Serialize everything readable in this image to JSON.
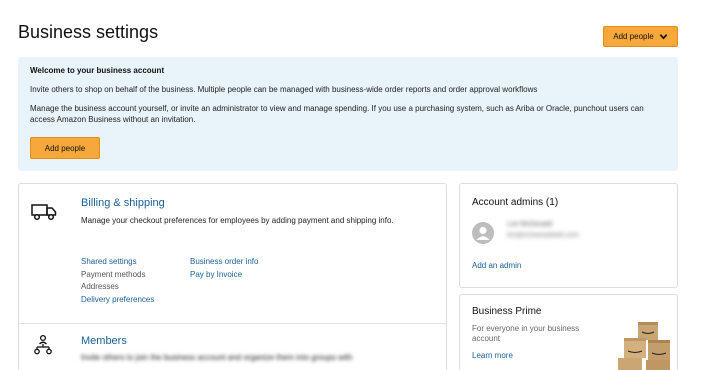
{
  "header": {
    "title": "Business settings",
    "add_people_dropdown": "Add people"
  },
  "welcome": {
    "title": "Welcome to your business account",
    "text1": "Invite others to shop on behalf of the business. Multiple people can be managed with business-wide order reports and order approval workflows",
    "text2": "Manage the business account yourself, or invite an administrator to view and manage spending. If you use a purchasing system, such as Ariba or Oracle, punchout users can access Amazon Business without an invitation.",
    "button": "Add people"
  },
  "billing": {
    "icon": "truck-icon",
    "title": "Billing & shipping",
    "description": "Manage your checkout preferences for employees by adding payment and shipping info.",
    "links_col1": {
      "shared_settings": "Shared settings",
      "payment_methods": "Payment methods",
      "addresses": "Addresses",
      "delivery_preferences": "Delivery preferences"
    },
    "links_col2": {
      "business_order_info": "Business order info",
      "pay_by_invoice": "Pay by Invoice"
    }
  },
  "members": {
    "icon": "people-network-icon",
    "title": "Members",
    "description": "Invite others to join the business account and organize them into groups with"
  },
  "admins": {
    "title": "Account admins (1)",
    "admin_name": "Lori McDonald",
    "admin_email": "lori@richwoodwell.com",
    "add_admin": "Add an admin"
  },
  "prime": {
    "title": "Business Prime",
    "description": "For everyone in your business account",
    "link": "Learn more"
  },
  "colors": {
    "accent_button": "#f7a83a",
    "link": "#1a5f96",
    "welcome_bg": "#e9f3fa"
  }
}
